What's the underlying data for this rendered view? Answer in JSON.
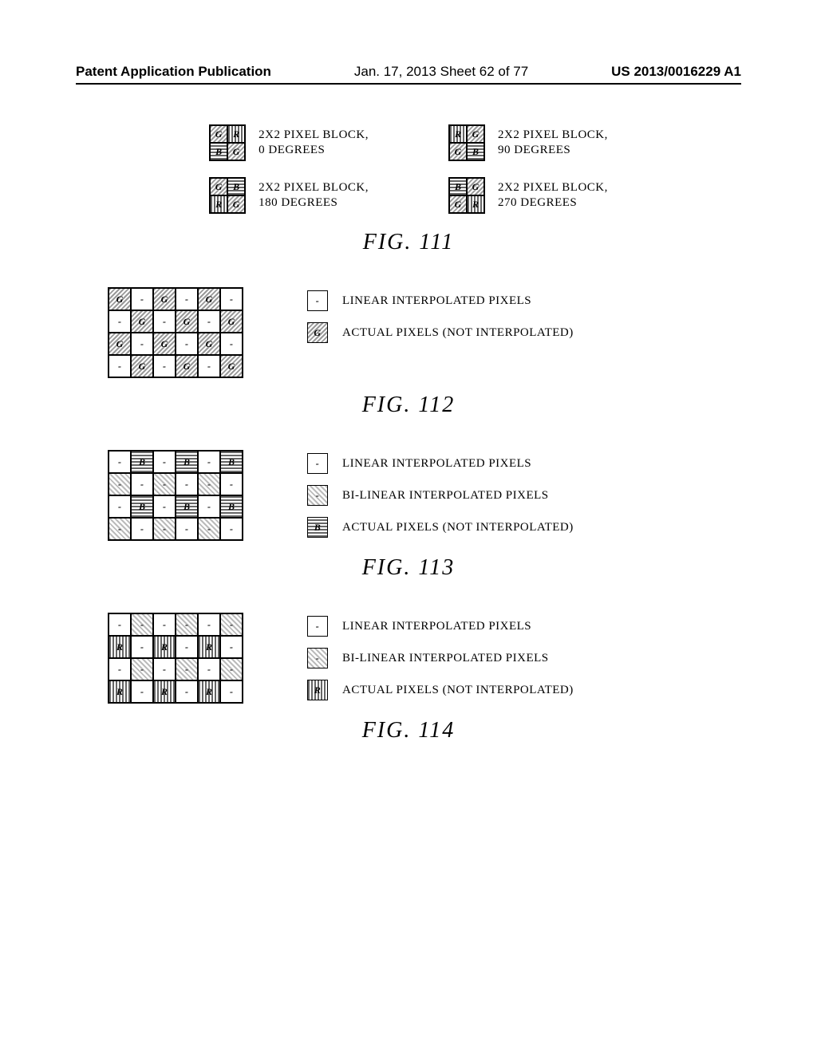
{
  "header": {
    "left": "Patent Application Publication",
    "mid": "Jan. 17, 2013  Sheet 62 of 77",
    "right": "US 2013/0016229 A1"
  },
  "fig111": {
    "blocks": [
      {
        "layout": [
          "G",
          "R",
          "B",
          "G"
        ],
        "label_l1": "2X2 PIXEL BLOCK,",
        "label_l2": "0 DEGREES"
      },
      {
        "layout": [
          "R",
          "G",
          "G",
          "B"
        ],
        "label_l1": "2X2 PIXEL BLOCK,",
        "label_l2": "90 DEGREES"
      },
      {
        "layout": [
          "G",
          "B",
          "R",
          "G"
        ],
        "label_l1": "2X2 PIXEL BLOCK,",
        "label_l2": "180 DEGREES"
      },
      {
        "layout": [
          "B",
          "G",
          "G",
          "R"
        ],
        "label_l1": "2X2 PIXEL BLOCK,",
        "label_l2": "270 DEGREES"
      }
    ],
    "caption": "FIG. 111"
  },
  "fig112": {
    "grid": [
      [
        "G",
        "-",
        "G",
        "-",
        "G",
        "-"
      ],
      [
        "-",
        "G",
        "-",
        "G",
        "-",
        "G"
      ],
      [
        "G",
        "-",
        "G",
        "-",
        "G",
        "-"
      ],
      [
        "-",
        "G",
        "-",
        "G",
        "-",
        "G"
      ]
    ],
    "legend": [
      {
        "sym": "-",
        "style": "plain",
        "text": "LINEAR INTERPOLATED PIXELS"
      },
      {
        "sym": "G",
        "style": "g-diag",
        "text": "ACTUAL PIXELS (NOT INTERPOLATED)"
      }
    ],
    "caption": "FIG. 112"
  },
  "fig113": {
    "grid": [
      [
        "-",
        "B",
        "-",
        "B",
        "-",
        "B"
      ],
      [
        "d",
        "-",
        "d",
        "-",
        "d",
        "-"
      ],
      [
        "-",
        "B",
        "-",
        "B",
        "-",
        "B"
      ],
      [
        "d",
        "-",
        "d",
        "-",
        "d",
        "-"
      ]
    ],
    "legend": [
      {
        "sym": "-",
        "style": "plain",
        "text": "LINEAR INTERPOLATED PIXELS"
      },
      {
        "sym": "-",
        "style": "diag45",
        "text": "BI-LINEAR INTERPOLATED PIXELS"
      },
      {
        "sym": "B",
        "style": "b-horiz",
        "text": "ACTUAL PIXELS (NOT INTERPOLATED)"
      }
    ],
    "caption": "FIG. 113"
  },
  "fig114": {
    "grid": [
      [
        "-",
        "d",
        "-",
        "d",
        "-",
        "d"
      ],
      [
        "R",
        "-",
        "R",
        "-",
        "R",
        "-"
      ],
      [
        "-",
        "d",
        "-",
        "d",
        "-",
        "d"
      ],
      [
        "R",
        "-",
        "R",
        "-",
        "R",
        "-"
      ]
    ],
    "legend": [
      {
        "sym": "-",
        "style": "plain",
        "text": "LINEAR INTERPOLATED PIXELS"
      },
      {
        "sym": "-",
        "style": "diag45",
        "text": "BI-LINEAR INTERPOLATED PIXELS"
      },
      {
        "sym": "R",
        "style": "r-vert",
        "text": "ACTUAL PIXELS (NOT INTERPOLATED)"
      }
    ],
    "caption": "FIG. 114"
  },
  "chart_data": [
    {
      "type": "table",
      "title": "FIG. 111 — 2x2 Bayer pixel block rotations",
      "blocks": [
        {
          "rotation_deg": 0,
          "cells_row_major": [
            "G",
            "R",
            "B",
            "G"
          ]
        },
        {
          "rotation_deg": 90,
          "cells_row_major": [
            "R",
            "G",
            "G",
            "B"
          ]
        },
        {
          "rotation_deg": 180,
          "cells_row_major": [
            "G",
            "B",
            "R",
            "G"
          ]
        },
        {
          "rotation_deg": 270,
          "cells_row_major": [
            "B",
            "G",
            "G",
            "R"
          ]
        }
      ]
    },
    {
      "type": "table",
      "title": "FIG. 112 — Green plane interpolation map (6x4)",
      "legend": {
        "-": "linear interpolated",
        "G": "actual pixel"
      },
      "grid": [
        [
          "G",
          "-",
          "G",
          "-",
          "G",
          "-"
        ],
        [
          "-",
          "G",
          "-",
          "G",
          "-",
          "G"
        ],
        [
          "G",
          "-",
          "G",
          "-",
          "G",
          "-"
        ],
        [
          "-",
          "G",
          "-",
          "G",
          "-",
          "G"
        ]
      ]
    },
    {
      "type": "table",
      "title": "FIG. 113 — Blue plane interpolation map (6x4)",
      "legend": {
        "-": "linear interpolated",
        "d": "bi-linear interpolated",
        "B": "actual pixel"
      },
      "grid": [
        [
          "-",
          "B",
          "-",
          "B",
          "-",
          "B"
        ],
        [
          "d",
          "-",
          "d",
          "-",
          "d",
          "-"
        ],
        [
          "-",
          "B",
          "-",
          "B",
          "-",
          "B"
        ],
        [
          "d",
          "-",
          "d",
          "-",
          "d",
          "-"
        ]
      ]
    },
    {
      "type": "table",
      "title": "FIG. 114 — Red plane interpolation map (6x4)",
      "legend": {
        "-": "linear interpolated",
        "d": "bi-linear interpolated",
        "R": "actual pixel"
      },
      "grid": [
        [
          "-",
          "d",
          "-",
          "d",
          "-",
          "d"
        ],
        [
          "R",
          "-",
          "R",
          "-",
          "R",
          "-"
        ],
        [
          "-",
          "d",
          "-",
          "d",
          "-",
          "d"
        ],
        [
          "R",
          "-",
          "R",
          "-",
          "R",
          "-"
        ]
      ]
    }
  ]
}
